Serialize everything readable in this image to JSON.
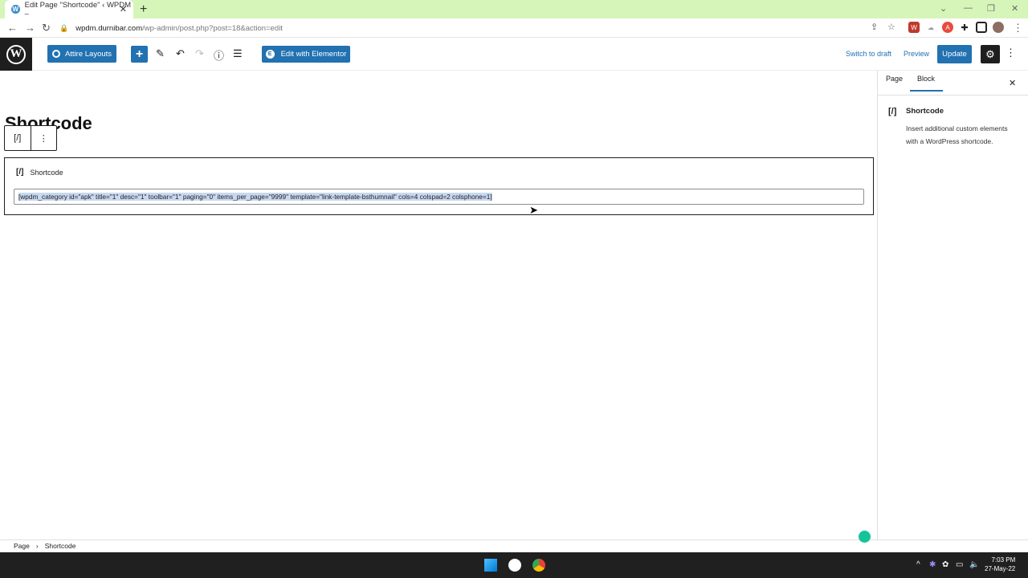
{
  "browser": {
    "tab_title": "Edit Page \"Shortcode\" ‹ WPDM –",
    "tab_close": "✕",
    "new_tab": "+",
    "url_domain": "wpdm.durnibar.com",
    "url_path": "/wp-admin/post.php?post=18&action=edit"
  },
  "toolbar": {
    "attire_label": "Attire Layouts",
    "add_block": "+",
    "elementor_label": "Edit with Elementor",
    "switch_to_draft": "Switch to draft",
    "preview": "Preview",
    "update": "Update"
  },
  "editor": {
    "page_title": "Shortcode",
    "block_icon": "[/]",
    "block_more": "⋮",
    "block_label": "Shortcode",
    "shortcode_value": "[wpdm_category id=\"apk\" title=\"1\" desc=\"1\" toolbar=\"1\" paging=\"0\" items_per_page=\"9999\" template=\"link-template-bsthumnail\" cols=4 colspad=2 colsphone=1]"
  },
  "sidebar": {
    "tab_page": "Page",
    "tab_block": "Block",
    "close": "✕",
    "block_icon": "[/]",
    "block_title": "Shortcode",
    "block_description": "Insert additional custom elements with a WordPress shortcode."
  },
  "footer": {
    "crumb_page": "Page",
    "crumb_sep": "›",
    "crumb_block": "Shortcode"
  },
  "taskbar": {
    "time": "7:03 PM",
    "date": "27-May-22"
  },
  "colors": {
    "accent": "#2271b1",
    "tabbar_bg": "#d6f5b8",
    "taskbar_bg": "#202020"
  }
}
